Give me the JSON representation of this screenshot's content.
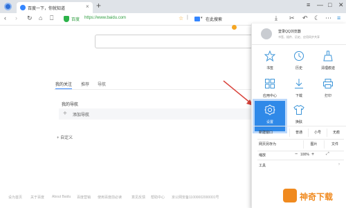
{
  "tab": {
    "title": "百度一下，你就知道"
  },
  "toolbar": {
    "secure_label": "百度",
    "url": "https://www.baidu.com",
    "search_text": "在此搜索"
  },
  "page": {
    "nav_tabs": [
      "我的关注",
      "推荐",
      "导航"
    ],
    "my_nav_title": "我的导航",
    "add_nav_label": "添加导航",
    "customize_label": "+ 自定义",
    "footer_links": [
      "设为首页",
      "关于百度",
      "About Baidu",
      "百度营销",
      "使用百度前必读",
      "意见反馈",
      "帮助中心",
      "京公网安备11000002000001号"
    ]
  },
  "menu": {
    "login_title": "登录QQ浏览器",
    "login_sub": "书签、插件、历史、应用同步共享",
    "grid": [
      {
        "label": "书签",
        "icon": "star-icon"
      },
      {
        "label": "历史",
        "icon": "clock-icon"
      },
      {
        "label": "清理痕迹",
        "icon": "broom-icon"
      },
      {
        "label": "应用中心",
        "icon": "apps-icon"
      },
      {
        "label": "下载",
        "icon": "download-icon"
      },
      {
        "label": "打印",
        "icon": "printer-icon"
      },
      {
        "label": "设置",
        "icon": "gear-icon"
      },
      {
        "label": "换肤",
        "icon": "shirt-icon"
      }
    ],
    "new_window": {
      "label": "新建窗口",
      "options": [
        "普通",
        "小号",
        "无痕"
      ]
    },
    "save_as": {
      "label": "网页另存为",
      "options": [
        "图片",
        "文件"
      ]
    },
    "zoom": {
      "label": "缩放",
      "minus": "−",
      "value": "100%",
      "plus": "+"
    },
    "more_label": "工具"
  },
  "watermark": {
    "text": "神奇下载"
  },
  "colors": {
    "accent": "#2f89e8",
    "icon_blue": "#3b94d8",
    "url_green": "#2c9c3e",
    "arrow_red": "#d9433b"
  }
}
